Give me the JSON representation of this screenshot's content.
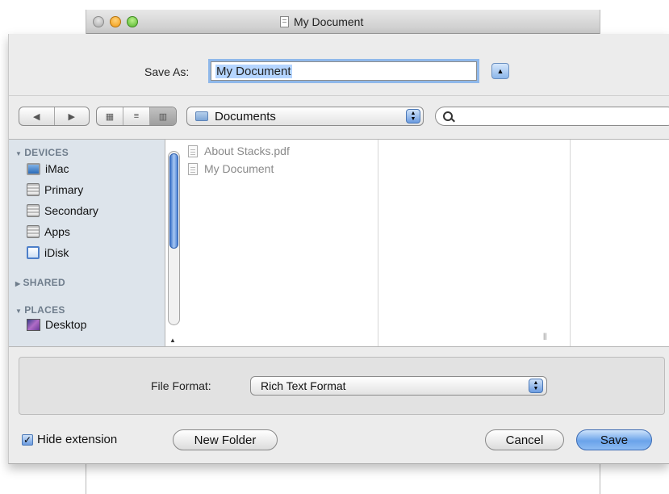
{
  "window": {
    "title": "My Document"
  },
  "save_as": {
    "label": "Save As:",
    "value": "My Document"
  },
  "toolbar": {
    "location": "Documents",
    "search_placeholder": ""
  },
  "sidebar": {
    "groups": [
      {
        "title": "DEVICES",
        "expanded": true,
        "items": [
          "iMac",
          "Primary",
          "Secondary",
          "Apps",
          "iDisk"
        ]
      },
      {
        "title": "SHARED",
        "expanded": false,
        "items": []
      },
      {
        "title": "PLACES",
        "expanded": true,
        "items": [
          "Desktop"
        ]
      }
    ]
  },
  "files": [
    {
      "name": "About Stacks.pdf"
    },
    {
      "name": "My Document"
    }
  ],
  "format": {
    "label": "File Format:",
    "value": "Rich Text Format"
  },
  "bottom": {
    "hide_extension_label": "Hide extension",
    "hide_extension_checked": true,
    "new_folder": "New Folder",
    "cancel": "Cancel",
    "save": "Save"
  },
  "colors": {
    "accent": "#6aa3ea",
    "sidebar_bg": "#dde4eb",
    "sheet_bg": "#ececec"
  }
}
